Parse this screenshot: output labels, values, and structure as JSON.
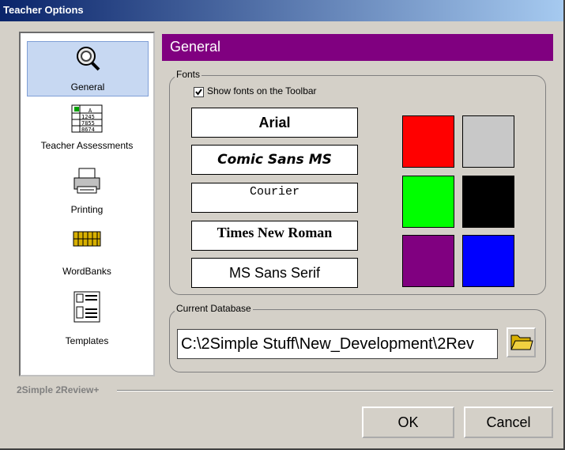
{
  "window": {
    "title": "Teacher Options"
  },
  "sidebar": {
    "items": [
      {
        "label": "General",
        "icon": "magnifier-icon",
        "selected": true
      },
      {
        "label": "Teacher Assessments",
        "icon": "spreadsheet-icon",
        "selected": false
      },
      {
        "label": "Printing",
        "icon": "printer-icon",
        "selected": false
      },
      {
        "label": "WordBanks",
        "icon": "wordbank-icon",
        "selected": false
      },
      {
        "label": "Templates",
        "icon": "template-icon",
        "selected": false
      }
    ]
  },
  "header": {
    "title": "General",
    "color": "#800080"
  },
  "fonts": {
    "group_label": "Fonts",
    "show_on_toolbar_label": "Show fonts on the Toolbar",
    "show_on_toolbar_checked": true,
    "font_list": [
      "Arial",
      "Comic Sans MS",
      "Courier",
      "Times New Roman",
      "MS Sans Serif"
    ],
    "colors": [
      "#ff0000",
      "#c8c8c8",
      "#00ff00",
      "#000000",
      "#800080",
      "#0000ff"
    ]
  },
  "database": {
    "group_label": "Current Database",
    "path": "C:\\2Simple Stuff\\New_Development\\2Rev"
  },
  "footer": {
    "app_name": "2Simple 2Review+"
  },
  "buttons": {
    "ok": "OK",
    "cancel": "Cancel"
  }
}
